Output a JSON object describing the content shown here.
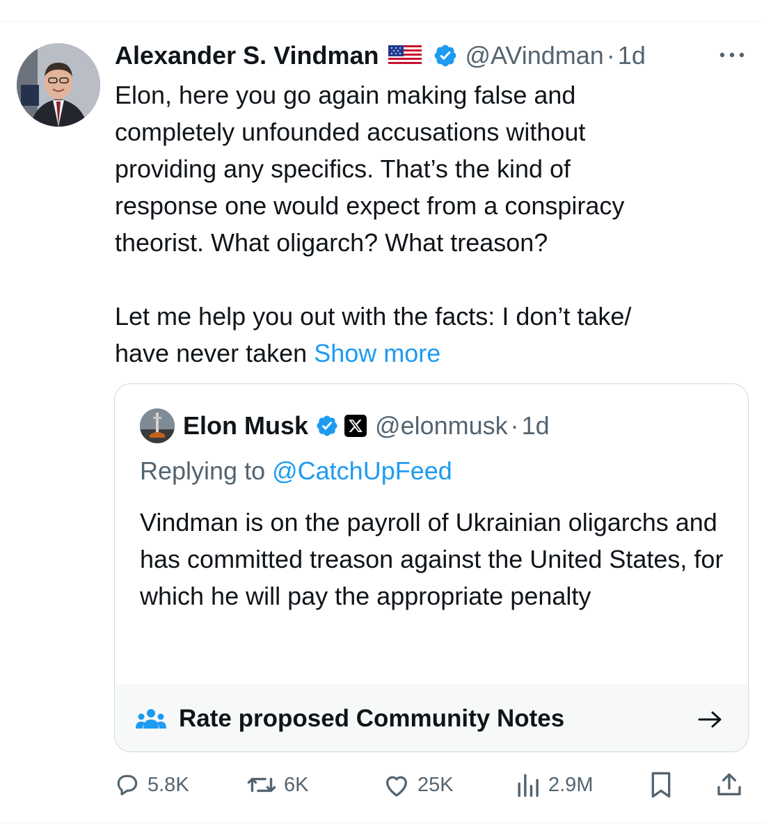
{
  "tweet": {
    "author_name": "Alexander S. Vindman",
    "handle": "@AVindman",
    "separator": "·",
    "time": "1d",
    "flag_icon": "us-flag-icon",
    "verified_color": "#1d9bf0",
    "text_part1": "Elon, here you go again making false and\ncompletely unfounded accusations without\nproviding any specifics. That’s the kind of\nresponse one would expect from a conspiracy\ntheorist. What oligarch? What treason?\n\nLet me help you out with the facts: I don’t take/\nhave never taken ",
    "show_more": "Show more"
  },
  "quote": {
    "author_name": "Elon Musk",
    "handle": "@elonmusk",
    "separator": "·",
    "time": "1d",
    "replying_prefix": "Replying to ",
    "replying_to": "@CatchUpFeed",
    "text": "Vindman is on the payroll of Ukrainian oligarchs and has committed treason against the United States, for which he will pay the appropriate penalty"
  },
  "community_notes": {
    "label": "Rate proposed Community Notes",
    "icon": "people-icon",
    "arrow_icon": "right-arrow-icon"
  },
  "actions": {
    "replies": "5.8K",
    "reposts": "6K",
    "likes": "25K",
    "views": "2.9M"
  },
  "colors": {
    "link": "#1d9bf0",
    "secondary_text": "#536471",
    "primary_text": "#0f1419",
    "border": "#cfd9de"
  }
}
